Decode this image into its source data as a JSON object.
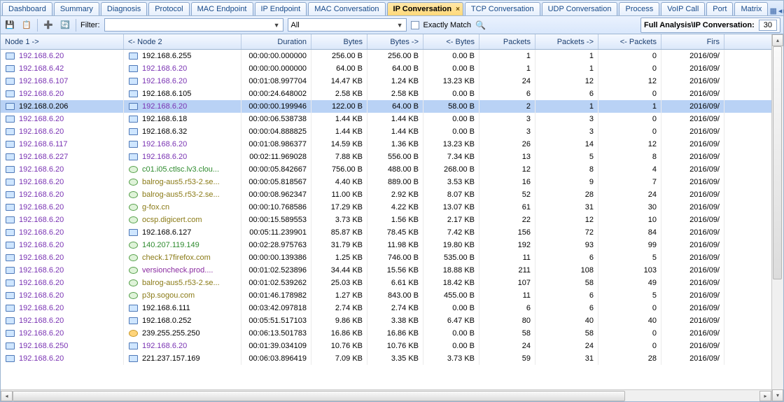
{
  "tabs": [
    "Dashboard",
    "Summary",
    "Diagnosis",
    "Protocol",
    "MAC Endpoint",
    "IP Endpoint",
    "MAC Conversation",
    "IP Conversation",
    "TCP Conversation",
    "UDP Conversation",
    "Process",
    "VoIP Call",
    "Port",
    "Matrix"
  ],
  "active_tab": "IP Conversation",
  "toolbar": {
    "filter_label": "Filter:",
    "filter_value": "",
    "scope": "All",
    "exact_label": "Exactly Match",
    "status_label": "Full Analysis\\IP Conversation:",
    "status_count": "30"
  },
  "columns": [
    {
      "label": "Node 1 ->",
      "align": "l",
      "w": "c0"
    },
    {
      "label": "<- Node 2",
      "align": "l",
      "w": "c1"
    },
    {
      "label": "Duration",
      "align": "r",
      "w": "c2"
    },
    {
      "label": "Bytes",
      "align": "r",
      "w": "c3"
    },
    {
      "label": "Bytes ->",
      "align": "r",
      "w": "c4"
    },
    {
      "label": "<- Bytes",
      "align": "r",
      "w": "c5"
    },
    {
      "label": "Packets",
      "align": "r",
      "w": "c6"
    },
    {
      "label": "Packets ->",
      "align": "r",
      "w": "c7"
    },
    {
      "label": "<- Packets",
      "align": "r",
      "w": "c8"
    },
    {
      "label": "Firs",
      "align": "r",
      "w": "c9"
    }
  ],
  "rows": [
    {
      "n1": "192.168.6.20",
      "c1": "ip",
      "n2": "192.168.6.255",
      "c2": "plain",
      "i2": "pc",
      "dur": "00:00:00.000000",
      "b": "256.00 B",
      "bo": "256.00 B",
      "bi": "0.00 B",
      "p": "1",
      "po": "1",
      "pi": "0",
      "t": "2016/09/"
    },
    {
      "n1": "192.168.6.42",
      "c1": "ip",
      "n2": "192.168.6.20",
      "c2": "ip",
      "i2": "pc",
      "dur": "00:00:00.000000",
      "b": "64.00 B",
      "bo": "64.00 B",
      "bi": "0.00 B",
      "p": "1",
      "po": "1",
      "pi": "0",
      "t": "2016/09/"
    },
    {
      "n1": "192.168.6.107",
      "c1": "ip",
      "n2": "192.168.6.20",
      "c2": "ip",
      "i2": "pc",
      "dur": "00:01:08.997704",
      "b": "14.47 KB",
      "bo": "1.24 KB",
      "bi": "13.23 KB",
      "p": "24",
      "po": "12",
      "pi": "12",
      "t": "2016/09/"
    },
    {
      "n1": "192.168.6.20",
      "c1": "ip",
      "n2": "192.168.6.105",
      "c2": "plain",
      "i2": "pc",
      "dur": "00:00:24.648002",
      "b": "2.58 KB",
      "bo": "2.58 KB",
      "bi": "0.00 B",
      "p": "6",
      "po": "6",
      "pi": "0",
      "t": "2016/09/"
    },
    {
      "sel": true,
      "n1": "192.168.0.206",
      "c1": "plain",
      "n2": "192.168.6.20",
      "c2": "ip",
      "i2": "pc",
      "dur": "00:00:00.199946",
      "b": "122.00 B",
      "bo": "64.00 B",
      "bi": "58.00 B",
      "p": "2",
      "po": "1",
      "pi": "1",
      "t": "2016/09/"
    },
    {
      "n1": "192.168.6.20",
      "c1": "ip",
      "n2": "192.168.6.18",
      "c2": "plain",
      "i2": "pc",
      "dur": "00:00:06.538738",
      "b": "1.44 KB",
      "bo": "1.44 KB",
      "bi": "0.00 B",
      "p": "3",
      "po": "3",
      "pi": "0",
      "t": "2016/09/"
    },
    {
      "n1": "192.168.6.20",
      "c1": "ip",
      "n2": "192.168.6.32",
      "c2": "plain",
      "i2": "pc",
      "dur": "00:00:04.888825",
      "b": "1.44 KB",
      "bo": "1.44 KB",
      "bi": "0.00 B",
      "p": "3",
      "po": "3",
      "pi": "0",
      "t": "2016/09/"
    },
    {
      "n1": "192.168.6.117",
      "c1": "ip",
      "n2": "192.168.6.20",
      "c2": "ip",
      "i2": "pc",
      "dur": "00:01:08.986377",
      "b": "14.59 KB",
      "bo": "1.36 KB",
      "bi": "13.23 KB",
      "p": "26",
      "po": "14",
      "pi": "12",
      "t": "2016/09/"
    },
    {
      "n1": "192.168.6.227",
      "c1": "ip",
      "n2": "192.168.6.20",
      "c2": "ip",
      "i2": "pc",
      "dur": "00:02:11.969028",
      "b": "7.88 KB",
      "bo": "556.00 B",
      "bi": "7.34 KB",
      "p": "13",
      "po": "5",
      "pi": "8",
      "t": "2016/09/"
    },
    {
      "n1": "192.168.6.20",
      "c1": "ip",
      "n2": "c01.i05.ctlsc.lv3.clou...",
      "c2": "host-green",
      "i2": "globe",
      "dur": "00:00:05.842667",
      "b": "756.00 B",
      "bo": "488.00 B",
      "bi": "268.00 B",
      "p": "12",
      "po": "8",
      "pi": "4",
      "t": "2016/09/"
    },
    {
      "n1": "192.168.6.20",
      "c1": "ip",
      "n2": "balrog-aus5.r53-2.se...",
      "c2": "host-olive",
      "i2": "globe",
      "dur": "00:00:05.818567",
      "b": "4.40 KB",
      "bo": "889.00 B",
      "bi": "3.53 KB",
      "p": "16",
      "po": "9",
      "pi": "7",
      "t": "2016/09/"
    },
    {
      "n1": "192.168.6.20",
      "c1": "ip",
      "n2": "balrog-aus5.r53-2.se...",
      "c2": "host-olive",
      "i2": "globe",
      "dur": "00:00:08.962347",
      "b": "11.00 KB",
      "bo": "2.92 KB",
      "bi": "8.07 KB",
      "p": "52",
      "po": "28",
      "pi": "24",
      "t": "2016/09/"
    },
    {
      "n1": "192.168.6.20",
      "c1": "ip",
      "n2": "g-fox.cn",
      "c2": "host-olive",
      "i2": "globe",
      "dur": "00:00:10.768586",
      "b": "17.29 KB",
      "bo": "4.22 KB",
      "bi": "13.07 KB",
      "p": "61",
      "po": "31",
      "pi": "30",
      "t": "2016/09/"
    },
    {
      "n1": "192.168.6.20",
      "c1": "ip",
      "n2": "ocsp.digicert.com",
      "c2": "host-olive",
      "i2": "globe",
      "dur": "00:00:15.589553",
      "b": "3.73 KB",
      "bo": "1.56 KB",
      "bi": "2.17 KB",
      "p": "22",
      "po": "12",
      "pi": "10",
      "t": "2016/09/"
    },
    {
      "n1": "192.168.6.20",
      "c1": "ip",
      "n2": "192.168.6.127",
      "c2": "plain",
      "i2": "pc",
      "dur": "00:05:11.239901",
      "b": "85.87 KB",
      "bo": "78.45 KB",
      "bi": "7.42 KB",
      "p": "156",
      "po": "72",
      "pi": "84",
      "t": "2016/09/"
    },
    {
      "n1": "192.168.6.20",
      "c1": "ip",
      "n2": "140.207.119.149",
      "c2": "host-green",
      "i2": "globe",
      "dur": "00:02:28.975763",
      "b": "31.79 KB",
      "bo": "11.98 KB",
      "bi": "19.80 KB",
      "p": "192",
      "po": "93",
      "pi": "99",
      "t": "2016/09/"
    },
    {
      "n1": "192.168.6.20",
      "c1": "ip",
      "n2": "check.17firefox.com",
      "c2": "host-olive",
      "i2": "globe",
      "dur": "00:00:00.139386",
      "b": "1.25 KB",
      "bo": "746.00 B",
      "bi": "535.00 B",
      "p": "11",
      "po": "6",
      "pi": "5",
      "t": "2016/09/"
    },
    {
      "n1": "192.168.6.20",
      "c1": "ip",
      "n2": "versioncheck.prod....",
      "c2": "host-purple",
      "i2": "globe",
      "dur": "00:01:02.523896",
      "b": "34.44 KB",
      "bo": "15.56 KB",
      "bi": "18.88 KB",
      "p": "211",
      "po": "108",
      "pi": "103",
      "t": "2016/09/"
    },
    {
      "n1": "192.168.6.20",
      "c1": "ip",
      "n2": "balrog-aus5.r53-2.se...",
      "c2": "host-olive",
      "i2": "globe",
      "dur": "00:01:02.539262",
      "b": "25.03 KB",
      "bo": "6.61 KB",
      "bi": "18.42 KB",
      "p": "107",
      "po": "58",
      "pi": "49",
      "t": "2016/09/"
    },
    {
      "n1": "192.168.6.20",
      "c1": "ip",
      "n2": "p3p.sogou.com",
      "c2": "host-olive",
      "i2": "globe",
      "dur": "00:01:46.178982",
      "b": "1.27 KB",
      "bo": "843.00 B",
      "bi": "455.00 B",
      "p": "11",
      "po": "6",
      "pi": "5",
      "t": "2016/09/"
    },
    {
      "n1": "192.168.6.20",
      "c1": "ip",
      "n2": "192.168.6.111",
      "c2": "plain",
      "i2": "pc",
      "dur": "00:03:42.097818",
      "b": "2.74 KB",
      "bo": "2.74 KB",
      "bi": "0.00 B",
      "p": "6",
      "po": "6",
      "pi": "0",
      "t": "2016/09/"
    },
    {
      "n1": "192.168.6.20",
      "c1": "ip",
      "n2": "192.168.0.252",
      "c2": "plain",
      "i2": "pc",
      "dur": "00:05:51.517103",
      "b": "9.86 KB",
      "bo": "3.38 KB",
      "bi": "6.47 KB",
      "p": "80",
      "po": "40",
      "pi": "40",
      "t": "2016/09/"
    },
    {
      "n1": "192.168.6.20",
      "c1": "ip",
      "n2": "239.255.255.250",
      "c2": "plain",
      "i2": "star",
      "dur": "00:06:13.501783",
      "b": "16.86 KB",
      "bo": "16.86 KB",
      "bi": "0.00 B",
      "p": "58",
      "po": "58",
      "pi": "0",
      "t": "2016/09/"
    },
    {
      "n1": "192.168.6.250",
      "c1": "ip",
      "n2": "192.168.6.20",
      "c2": "ip",
      "i2": "pc",
      "dur": "00:01:39.034109",
      "b": "10.76 KB",
      "bo": "10.76 KB",
      "bi": "0.00 B",
      "p": "24",
      "po": "24",
      "pi": "0",
      "t": "2016/09/"
    },
    {
      "n1": "192.168.6.20",
      "c1": "ip",
      "n2": "221.237.157.169",
      "c2": "plain",
      "i2": "pc",
      "dur": "00:06:03.896419",
      "b": "7.09 KB",
      "bo": "3.35 KB",
      "bi": "3.73 KB",
      "p": "59",
      "po": "31",
      "pi": "28",
      "t": "2016/09/"
    }
  ]
}
